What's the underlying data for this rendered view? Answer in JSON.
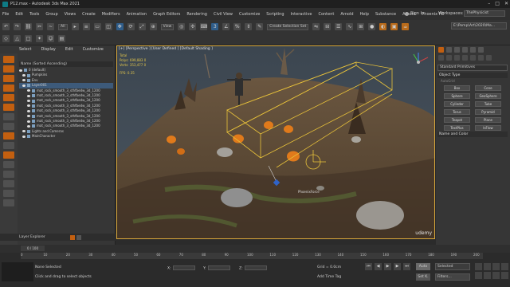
{
  "window": {
    "title": "P12.max - Autodesk 3ds Max 2021"
  },
  "menu": {
    "items": [
      "File",
      "Edit",
      "Tools",
      "Group",
      "Views",
      "Create",
      "Modifiers",
      "Animation",
      "Graph Editors",
      "Rendering",
      "Civil View",
      "Customize",
      "Scripting",
      "Interactive",
      "Content",
      "Arnold",
      "Help",
      "Substance",
      "Arnold",
      "Phoenix FD"
    ],
    "signin": "Sign In",
    "workspaces_label": "Workspaces:",
    "workspace_value": "ThePhysicist"
  },
  "toolbar": {
    "filter_dd": "All",
    "view_dd": "View",
    "selection_set": "Create Selection Set",
    "path_dd": "E:\\Pomp\\Art\\2020\\Ma..."
  },
  "scene_explorer": {
    "tabs": [
      "Select",
      "Display",
      "Edit",
      "Customize"
    ],
    "header": "Name (Sorted Ascending)",
    "rows": [
      "0 (default)",
      "Pumpkins",
      "Env",
      "Layer001",
      "mat_rock_smooth_3_sthfbedw_3d_1200",
      "mat_rock_smooth_3_sthfbedw_3d_1200",
      "mat_rock_smooth_3_sthfbedw_3d_1200",
      "mat_rock_smooth_3_sthfbedw_3d_1200",
      "mat_rock_smooth_3_sthfbedw_3d_1200",
      "mat_rock_smooth_3_sthfbedw_3d_1200",
      "mat_rock_smooth_3_sthfbedw_3d_1200",
      "mat_rock_smooth_3_sthfbedw_3d_1200",
      "Lights and Cameras",
      "MainCharacter"
    ],
    "selected_index": 3,
    "layer_explorer": "Layer Explorer"
  },
  "viewport": {
    "label": "[+] [Perspective ] [User Defined ] [Default Shading ]",
    "stats": {
      "total_label": "Total",
      "polys_label": "Polys:",
      "polys_value": "699,883",
      "polys_value2": "0",
      "verts_label": "Verts:",
      "verts_value": "353,477",
      "verts_value2": "0",
      "fps_label": "FPS:",
      "fps_value": "0.35"
    },
    "object_label": "PhoenixForce",
    "watermark": "udemy"
  },
  "command_panel": {
    "category_dd": "Standard Primitives",
    "object_type_title": "Object Type",
    "autogrid": "AutoGrid",
    "primitives": [
      "Box",
      "Cone",
      "Sphere",
      "GeoSphere",
      "Cylinder",
      "Tube",
      "Torus",
      "Pyramid",
      "Teapot",
      "Plane",
      "TextPlus",
      "IsFlow"
    ],
    "name_color_title": "Name and Color"
  },
  "timeline": {
    "range": "0 / 100",
    "ticks": [
      "0",
      "10",
      "20",
      "30",
      "40",
      "50",
      "60",
      "70",
      "80",
      "90",
      "100",
      "110",
      "120",
      "130",
      "140",
      "150",
      "160",
      "170",
      "180",
      "190",
      "200"
    ]
  },
  "status": {
    "selection": "None Selected",
    "hint": "Click and drag to select objects",
    "x_label": "X:",
    "y_label": "Y:",
    "z_label": "Z:",
    "grid": "Grid = 0.0cm",
    "add_time_tag": "Add Time Tag",
    "auto_key": "Auto",
    "set_key": "Set K.",
    "selected_dd": "Selected",
    "filters": "Filters..."
  },
  "colors": {
    "accent_orange": "#c25f10",
    "viewport_border": "#d9a83b",
    "gizmo_yellow": "#e8c23a",
    "pumpkin": "#e07a1b"
  }
}
